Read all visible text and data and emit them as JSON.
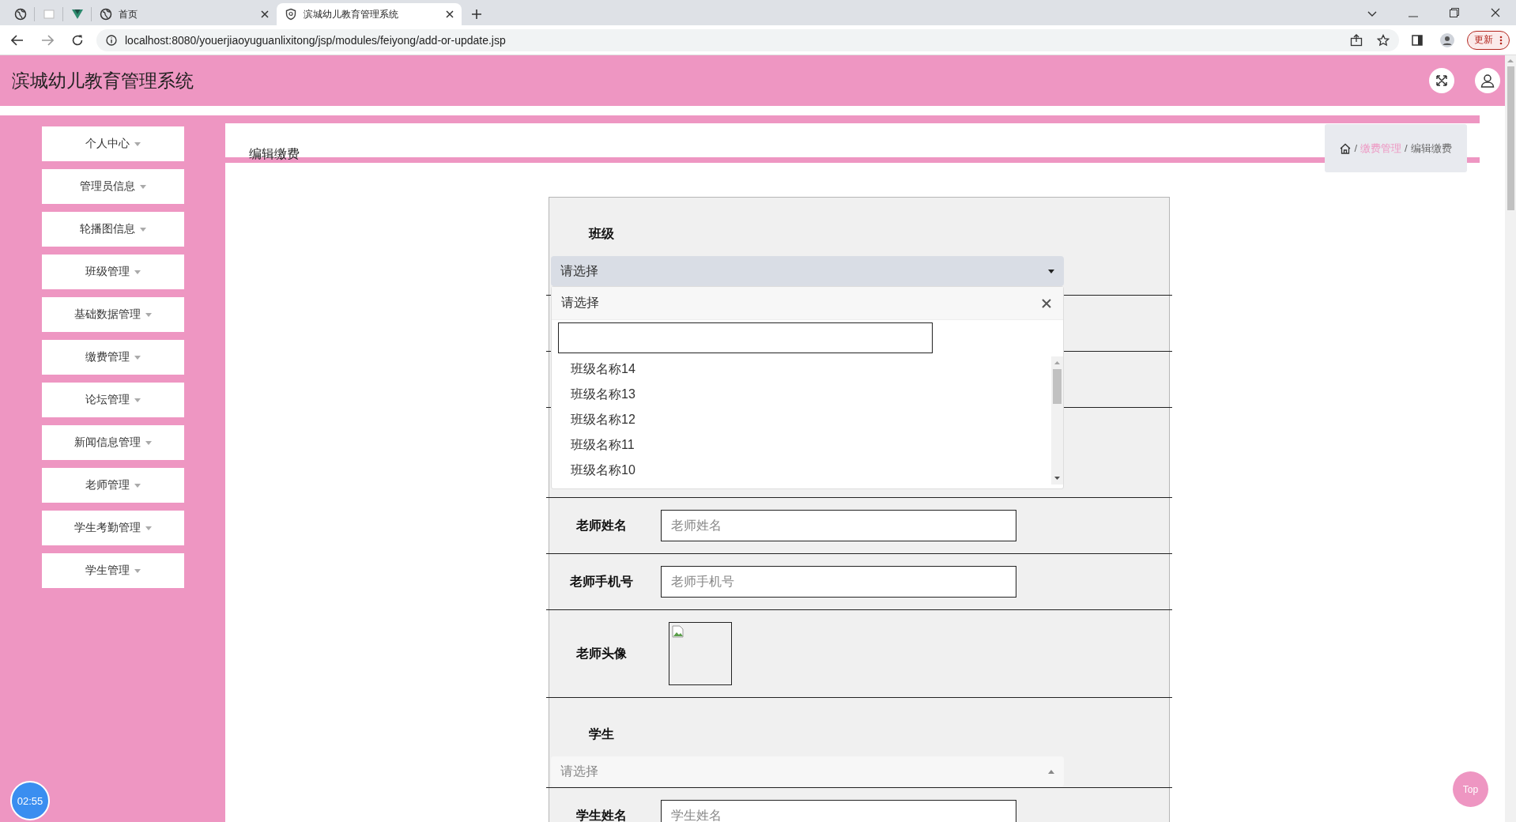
{
  "browser": {
    "tabs": [
      {
        "kind": "pinned",
        "selected": false
      },
      {
        "kind": "pinned",
        "selected": false
      },
      {
        "kind": "pinned",
        "selected": false
      },
      {
        "kind": "page",
        "title": "首页",
        "selected": false
      },
      {
        "kind": "page",
        "title": "滨城幼儿教育管理系统",
        "selected": true
      }
    ],
    "url": "localhost:8080/youerjiaoyuguanlixitong/jsp/modules/feiyong/add-or-update.jsp",
    "update_button": "更新"
  },
  "header": {
    "title": "滨城幼儿教育管理系统"
  },
  "sidebar": {
    "items": [
      {
        "label": "个人中心"
      },
      {
        "label": "管理员信息"
      },
      {
        "label": "轮播图信息"
      },
      {
        "label": "班级管理"
      },
      {
        "label": "基础数据管理"
      },
      {
        "label": "缴费管理"
      },
      {
        "label": "论坛管理"
      },
      {
        "label": "新闻信息管理"
      },
      {
        "label": "老师管理"
      },
      {
        "label": "学生考勤管理"
      },
      {
        "label": "学生管理"
      }
    ]
  },
  "page_title": "编辑缴费",
  "breadcrumb": [
    {
      "kind": "separator",
      "text": "/"
    },
    {
      "kind": "link",
      "text": "缴费管理"
    },
    {
      "kind": "separator",
      "text": "/"
    },
    {
      "kind": "current",
      "text": "编辑缴费"
    }
  ],
  "form": {
    "fields": [
      {
        "kind": "select",
        "label": "班级",
        "value": "请选择",
        "expanded": true,
        "dropdown": {
          "header": "请选择",
          "options": [
            {
              "label": "班级名称14"
            },
            {
              "label": "班级名称13"
            },
            {
              "label": "班级名称12"
            },
            {
              "label": "班级名称11"
            },
            {
              "label": "班级名称10"
            }
          ]
        }
      },
      {
        "kind": "blank"
      },
      {
        "kind": "blank"
      },
      {
        "kind": "tallblank"
      },
      {
        "kind": "input",
        "label": "老师姓名",
        "placeholder": "老师姓名"
      },
      {
        "kind": "input",
        "label": "老师手机号",
        "placeholder": "老师手机号"
      },
      {
        "kind": "image",
        "label": "老师头像"
      },
      {
        "kind": "select",
        "label": "学生",
        "placeholder": "请选择",
        "expanded": false
      },
      {
        "kind": "input",
        "label": "学生姓名",
        "placeholder": "学生姓名"
      }
    ]
  },
  "timer": "02:55",
  "top_button": "Top"
}
